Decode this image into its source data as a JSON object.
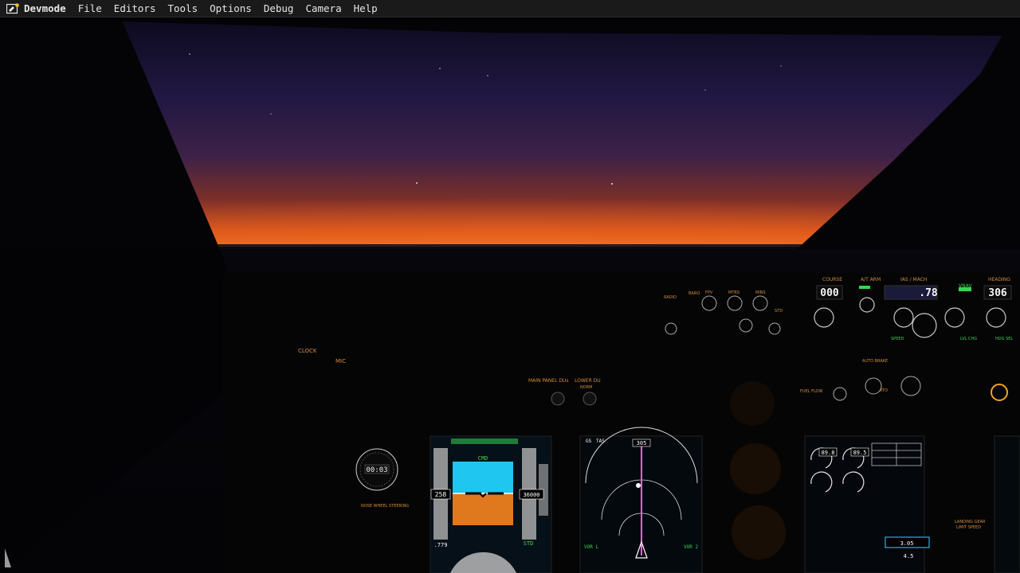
{
  "menubar": {
    "app_name": "Devmode",
    "items": [
      "File",
      "Editors",
      "Tools",
      "Options",
      "Debug",
      "Camera",
      "Help"
    ]
  },
  "icons": {
    "app_logo": "devmode-logo-icon"
  },
  "cockpit": {
    "left_panel": {
      "clock_label": "CLOCK",
      "mic_label": "MIC",
      "nose_wheel_steering": "NOSE WHEEL STEERING",
      "clock_time": "00:03"
    },
    "display_select": {
      "main_panel_du": "MAIN PANEL DUs",
      "lower_du": "LOWER DU",
      "norm": "NORM"
    },
    "mcp": {
      "course_label": "COURSE",
      "course_value": "000",
      "at_arm_label": "A/T ARM",
      "ias_mach_label": "IAS / MACH",
      "ias_mach_value": ".78",
      "vnav_label": "VNAV",
      "heading_label": "HEADING",
      "heading_value": "306",
      "speed_label": "SPEED",
      "lvl_chg_label": "LVL CHG",
      "hdg_sel_label": "HDG SEL"
    },
    "efis": {
      "baro": "BARO",
      "mins": "MINS",
      "fpv": "FPV",
      "mtrs": "MTRS",
      "std": "STD",
      "radio": "RADIO"
    },
    "autobrake": {
      "label": "AUTO BRAKE",
      "fuel_flow": "FUEL FLOW",
      "rto": "RTO"
    },
    "pfd": {
      "mach": ".779",
      "baro_setting": "STD",
      "speed": "258",
      "altitude": "36000",
      "mode_cmd": "CMD"
    },
    "nd": {
      "gs": "GS",
      "tas": "TAS",
      "heading": "305",
      "vor_l": "VOR L",
      "vor_r": "VOR 2"
    },
    "eicas": {
      "n1_left": "89.8",
      "n1_right": "89.5",
      "fuel": "3.05",
      "temp": "4.5"
    },
    "gear_panel": {
      "title": "LANDING GEAR",
      "subtitle": "LIMIT SPEED"
    }
  }
}
